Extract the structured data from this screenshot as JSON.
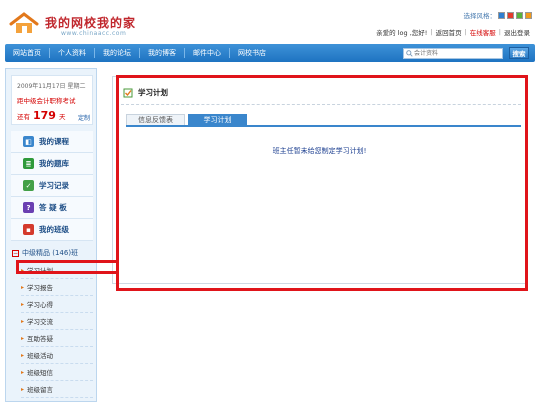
{
  "header": {
    "logo_title": "我的网校我的家",
    "logo_sub": "www.chinaacc.com",
    "style_label": "选择风格：",
    "style_swatches": [
      "#2e7fd1",
      "#e33a2c",
      "#58b33c",
      "#f29a1c"
    ],
    "greeting": "亲爱的 log ,您好!",
    "links": [
      {
        "label": "返回首页",
        "color": "#333333"
      },
      {
        "label": "在线客服",
        "color": "#d40000"
      },
      {
        "label": "退出登录",
        "color": "#333333"
      }
    ]
  },
  "nav": {
    "items": [
      "网站首页",
      "个人资料",
      "我的论坛",
      "我的博客",
      "邮件中心",
      "网校书店"
    ],
    "search_placeholder": "会计资料",
    "search_button": "搜索"
  },
  "sidebar": {
    "date": "2009年11月17日 星期二",
    "exam": "距中级会计职称考试",
    "remain_prefix": "还有",
    "remain_days": "179",
    "remain_unit": "天",
    "customize": "定制",
    "menu": [
      {
        "label": "我的课程",
        "icon": "course-icon",
        "color": "#3a86cc"
      },
      {
        "label": "我的题库",
        "icon": "question-bank-icon",
        "color": "#2f9a3a"
      },
      {
        "label": "学习记录",
        "icon": "record-icon",
        "color": "#43a047"
      },
      {
        "label": "答 疑 板",
        "icon": "question-mark-icon",
        "color": "#6a3fb1"
      },
      {
        "label": "我的班级",
        "icon": "class-icon",
        "color": "#d43a2c"
      }
    ],
    "class_name": "中级精品 (146)班",
    "sub_items": [
      "学习计划",
      "学习报告",
      "学习心得",
      "学习交流",
      "互助答疑",
      "班级活动",
      "班级短信",
      "班级留言"
    ]
  },
  "main": {
    "title": "学习计划",
    "tabs": [
      {
        "label": "信息反馈表",
        "active": false
      },
      {
        "label": "学习计划",
        "active": true
      }
    ],
    "notice": "班主任暂未给您制定学习计划!"
  }
}
